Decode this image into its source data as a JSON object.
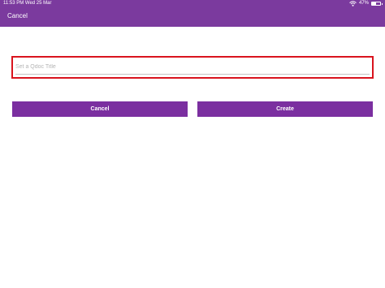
{
  "status_bar": {
    "time_date": "11:53 PM   Wed 25 Mar",
    "battery_percent": "47%",
    "battery_level": 0.47,
    "wifi_icon": "wifi-icon",
    "battery_icon": "battery-icon"
  },
  "nav": {
    "cancel_label": "Cancel"
  },
  "form": {
    "title_placeholder": "Set a Qdoc Title",
    "title_value": ""
  },
  "actions": {
    "cancel_label": "Cancel",
    "create_label": "Create"
  },
  "colors": {
    "header": "#7b3a9e",
    "button": "#7b2fa0",
    "highlight_border": "#d9141e"
  }
}
